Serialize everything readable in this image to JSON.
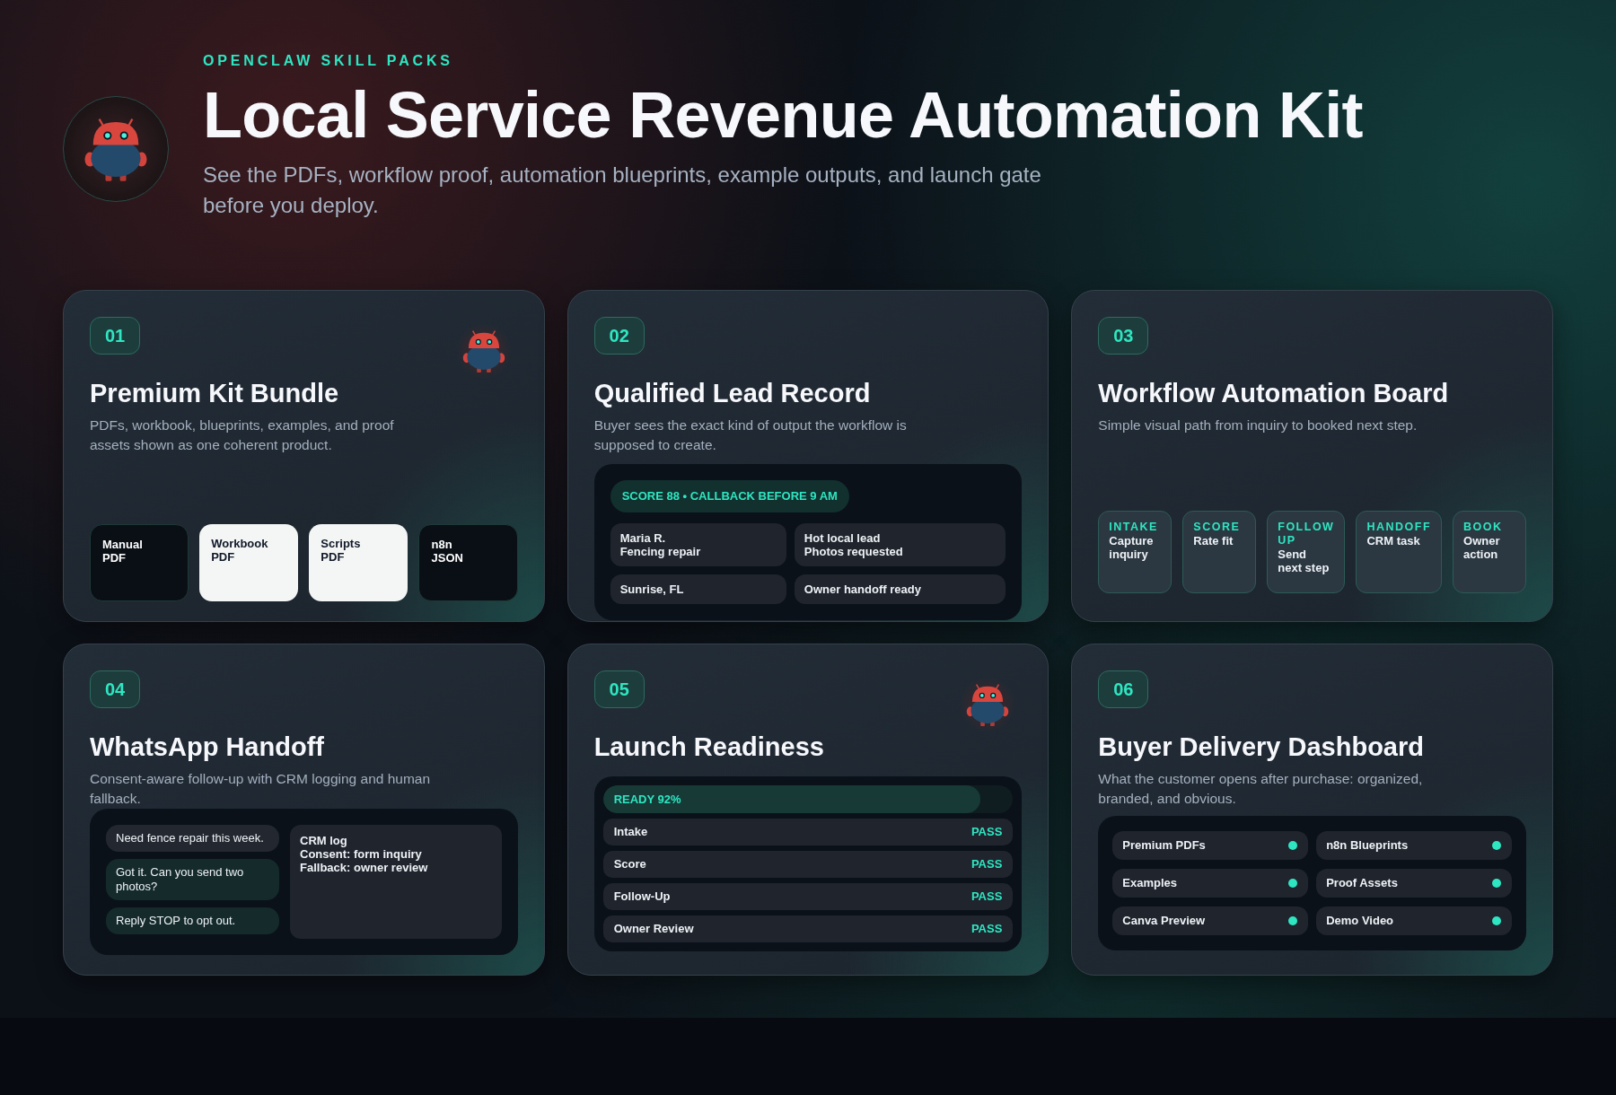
{
  "header": {
    "eyebrow": "OPENCLAW SKILL PACKS",
    "title": "Local Service Revenue Automation Kit",
    "subtitle": "See the PDFs, workflow proof, automation blueprints, example outputs, and launch gate before you deploy."
  },
  "cards": [
    {
      "kind": "tiles",
      "number": "01",
      "title": "Premium Kit Bundle",
      "description": "PDFs, workbook, blueprints, examples, and proof assets shown as one coherent product.",
      "mascot": true,
      "tiles": [
        {
          "lines": [
            "Manual",
            "PDF"
          ],
          "kind": "dark"
        },
        {
          "lines": [
            "Workbook",
            "PDF"
          ],
          "kind": "light"
        },
        {
          "lines": [
            "Scripts",
            "PDF"
          ],
          "kind": "light"
        },
        {
          "lines": [
            "n8n",
            "JSON"
          ],
          "kind": "dark"
        }
      ]
    },
    {
      "kind": "record",
      "number": "02",
      "title": "Qualified Lead Record",
      "description": "Buyer sees the exact kind of output the workflow is supposed to create.",
      "mascot": false,
      "badge": "SCORE 88 • CALLBACK BEFORE 9 AM",
      "fields": [
        {
          "lines": [
            "Maria R.",
            "Fencing repair"
          ]
        },
        {
          "lines": [
            "Hot local lead",
            "Photos requested"
          ]
        },
        {
          "lines": [
            "Sunrise, FL"
          ]
        },
        {
          "lines": [
            "Owner handoff ready"
          ]
        }
      ]
    },
    {
      "kind": "steps",
      "number": "03",
      "title": "Workflow Automation Board",
      "description": "Simple visual path from inquiry to booked next step.",
      "mascot": false,
      "steps": [
        {
          "label": "INTAKE",
          "text": [
            "Capture",
            "inquiry"
          ]
        },
        {
          "label": "SCORE",
          "text": [
            "Rate fit"
          ]
        },
        {
          "label": "FOLLOW UP",
          "text": [
            "Send",
            "next step"
          ]
        },
        {
          "label": "HANDOFF",
          "text": [
            "CRM task"
          ]
        },
        {
          "label": "BOOK",
          "text": [
            "Owner",
            "action"
          ]
        }
      ]
    },
    {
      "kind": "chat",
      "number": "04",
      "title": "WhatsApp Handoff",
      "description": "Consent-aware follow-up with CRM logging and human fallback.",
      "mascot": false,
      "messages": [
        {
          "text": "Need fence repair this week.",
          "kind": "incoming"
        },
        {
          "text": "Got it. Can you send two photos?",
          "kind": "outgoing"
        },
        {
          "text": "Reply STOP to opt out.",
          "kind": "outgoing"
        }
      ],
      "log": [
        "CRM log",
        "Consent: form inquiry",
        "Fallback: owner review"
      ]
    },
    {
      "kind": "checklist",
      "number": "05",
      "title": "Launch Readiness",
      "mascot": true,
      "progress": {
        "label": "READY 92%",
        "level": 0.92
      },
      "checks": [
        {
          "label": "Intake",
          "result": "PASS"
        },
        {
          "label": "Score",
          "result": "PASS"
        },
        {
          "label": "Follow-Up",
          "result": "PASS"
        },
        {
          "label": "Owner Review",
          "result": "PASS"
        }
      ]
    },
    {
      "kind": "deliverables",
      "number": "06",
      "title": "Buyer Delivery Dashboard",
      "description": "What the customer opens after purchase: organized, branded, and obvious.",
      "mascot": false,
      "items": [
        {
          "label": "Premium PDFs",
          "ready": true
        },
        {
          "label": "n8n Blueprints",
          "ready": true
        },
        {
          "label": "Examples",
          "ready": true
        },
        {
          "label": "Proof Assets",
          "ready": true
        },
        {
          "label": "Canva Preview",
          "ready": true
        },
        {
          "label": "Demo Video",
          "ready": true
        }
      ]
    }
  ]
}
